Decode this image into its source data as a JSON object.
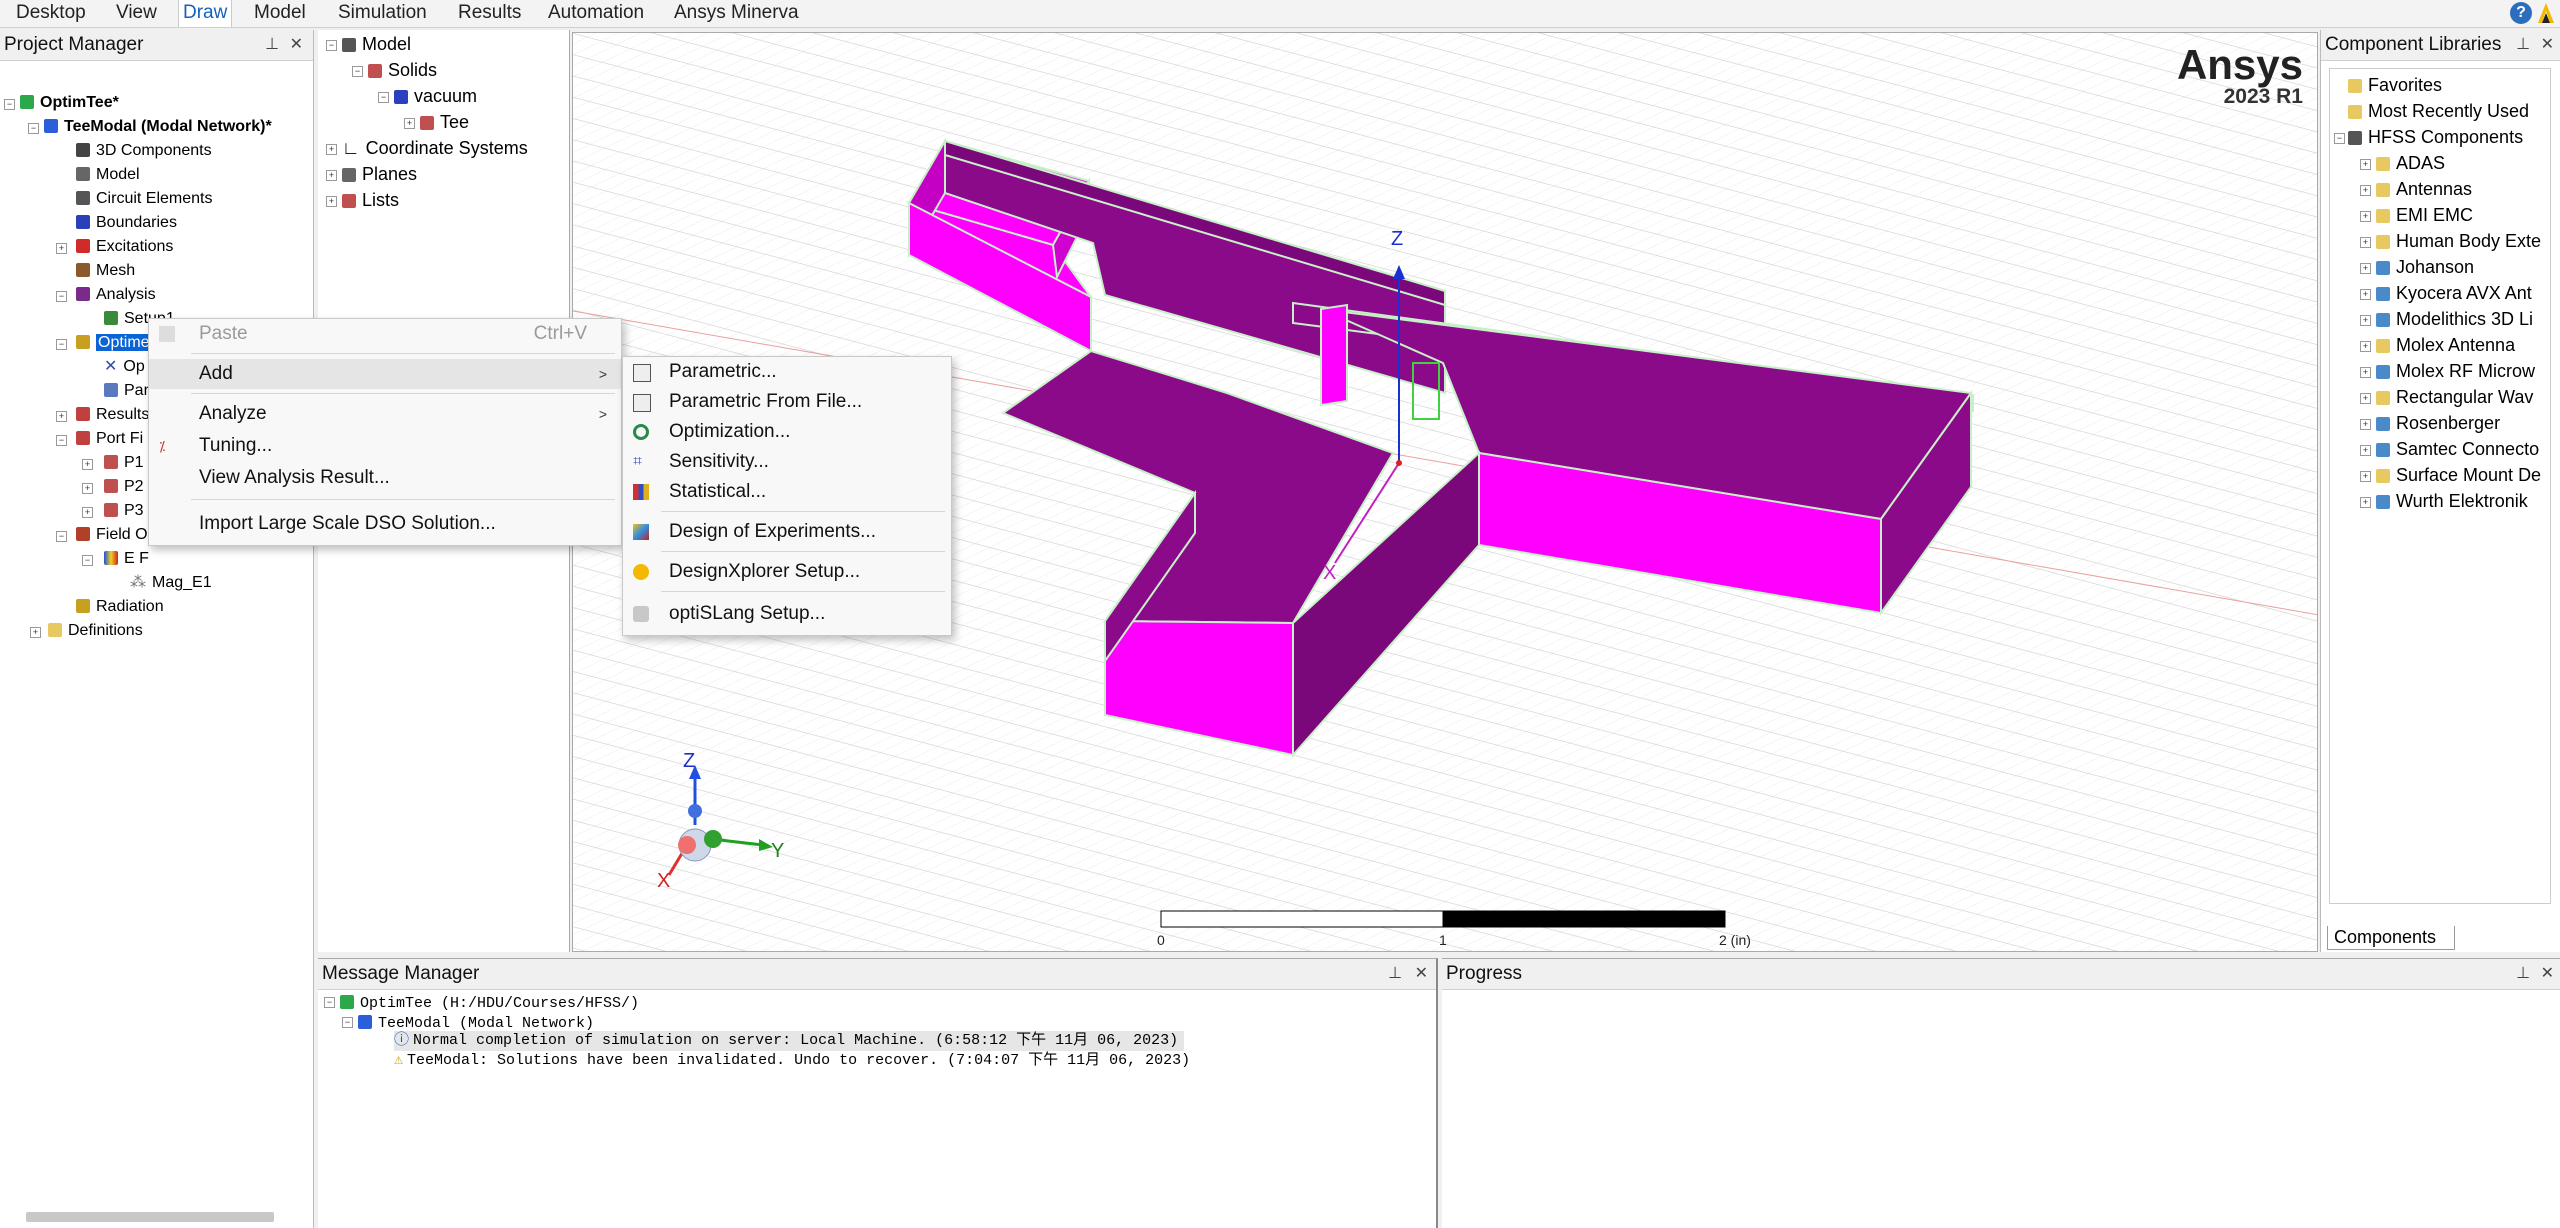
{
  "menubar": {
    "tabs": [
      "Desktop",
      "View",
      "Draw",
      "Model",
      "Simulation",
      "Results",
      "Automation",
      "Ansys Minerva"
    ],
    "active": "Draw"
  },
  "project_manager": {
    "title": "Project Manager",
    "project": "OptimTee*",
    "design": "TeeModal (Modal Network)*",
    "items": [
      "3D Components",
      "Model",
      "Circuit Elements",
      "Boundaries",
      "Excitations",
      "Mesh",
      "Analysis",
      "Setup1",
      "Optimetrics",
      "Op",
      "Par",
      "Results",
      "Port Fi",
      "P1",
      "P2",
      "P3",
      "Field O",
      "E F",
      "Mag_E1",
      "Radiation",
      "Definitions"
    ]
  },
  "model_tree": {
    "items": [
      "Model",
      "Solids",
      "vacuum",
      "Tee",
      "Coordinate Systems",
      "Planes",
      "Lists"
    ]
  },
  "context_menu": {
    "paste": "Paste",
    "paste_shortcut": "Ctrl+V",
    "add": "Add",
    "analyze": "Analyze",
    "tuning": "Tuning...",
    "view_result": "View Analysis Result...",
    "import_dso": "Import Large Scale DSO Solution..."
  },
  "submenu": {
    "parametric": "Parametric...",
    "parametric_file": "Parametric From File...",
    "optimization": "Optimization...",
    "sensitivity": "Sensitivity...",
    "statistical": "Statistical...",
    "doe": "Design of Experiments...",
    "designxplorer": "DesignXplorer Setup...",
    "optislang": "optiSLang Setup..."
  },
  "viewport": {
    "brand": "Ansys",
    "version": "2023 R1",
    "axis_z": "Z",
    "axis_x": "X",
    "axis_y": "Y",
    "scale_0": "0",
    "scale_1": "1",
    "scale_2": "2 (in)"
  },
  "component_libraries": {
    "title": "Component Libraries",
    "items": [
      "Favorites",
      "Most Recently Used",
      "HFSS Components",
      "ADAS",
      "Antennas",
      "EMI EMC",
      "Human Body Exte",
      "Johanson",
      "Kyocera AVX Ant",
      "Modelithics 3D Li",
      "Molex Antenna",
      "Molex RF Microw",
      "Rectangular Wav",
      "Rosenberger",
      "Samtec Connecto",
      "Surface Mount De",
      "Wurth Elektronik"
    ],
    "tab": "Components"
  },
  "message_manager": {
    "title": "Message Manager",
    "project_line": "OptimTee (H:/HDU/Courses/HFSS/)",
    "design_line": "TeeModal (Modal Network)",
    "msg1": "Normal completion of simulation on server: Local Machine. (6:58:12 下午  11月 06, 2023)",
    "msg2": "TeeModal: Solutions have been invalidated. Undo to recover. (7:04:07 下午  11月 06, 2023)"
  },
  "progress": {
    "title": "Progress"
  },
  "colors": {
    "accent": "#0a64d6",
    "solid": "#8c0a8c",
    "solid_side": "#ff00ff",
    "edge": "#b8ffb8"
  }
}
